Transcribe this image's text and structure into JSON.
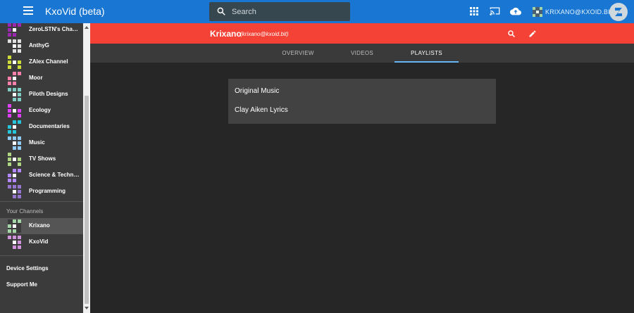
{
  "app": {
    "title": "KxoVid (beta)"
  },
  "search": {
    "placeholder": "Search"
  },
  "topbar": {
    "user_label": "KRIXANO@KXOID.BIT",
    "icons": [
      "apps-grid-icon",
      "cast-icon",
      "cloud-upload-icon",
      "zeronet-logo-icon"
    ]
  },
  "sidebar": {
    "subscriptions": [
      {
        "name": "ZeroLSTN's Chan...",
        "color": "#9c27b0"
      },
      {
        "name": "AnthyG",
        "color": "#e0e0e0"
      },
      {
        "name": "ZAlex Channel",
        "color": "#cddc39"
      },
      {
        "name": "Moor",
        "color": "#ff80ab"
      },
      {
        "name": "Piloth Designs",
        "color": "#80cbc4"
      },
      {
        "name": "Ecology",
        "color": "#e040fb"
      },
      {
        "name": "Documentaries",
        "color": "#26c6da"
      },
      {
        "name": "Music",
        "color": "#90caf9"
      },
      {
        "name": "TV Shows",
        "color": "#aed581"
      },
      {
        "name": "Science & Technol...",
        "color": "#b388ff"
      },
      {
        "name": "Programming",
        "color": "#9575cd"
      }
    ],
    "your_channels_heading": "Your Channels",
    "your_channels": [
      {
        "name": "Krixano",
        "color": "#a5d6a7"
      },
      {
        "name": "KxoVid",
        "color": "#ce93d8"
      }
    ],
    "links": [
      "Device Settings",
      "Support Me"
    ]
  },
  "channel": {
    "name": "Krixano",
    "address": "(krixano@kxoid.bit)",
    "header_color": "#f44336",
    "actions": [
      "search-icon",
      "edit-icon"
    ]
  },
  "tabs": [
    {
      "label": "OVERVIEW",
      "active": false
    },
    {
      "label": "VIDEOS",
      "active": false
    },
    {
      "label": "PLAYLISTS",
      "active": true
    }
  ],
  "playlists": [
    "Original Music",
    "Clay Aiken Lyrics"
  ]
}
